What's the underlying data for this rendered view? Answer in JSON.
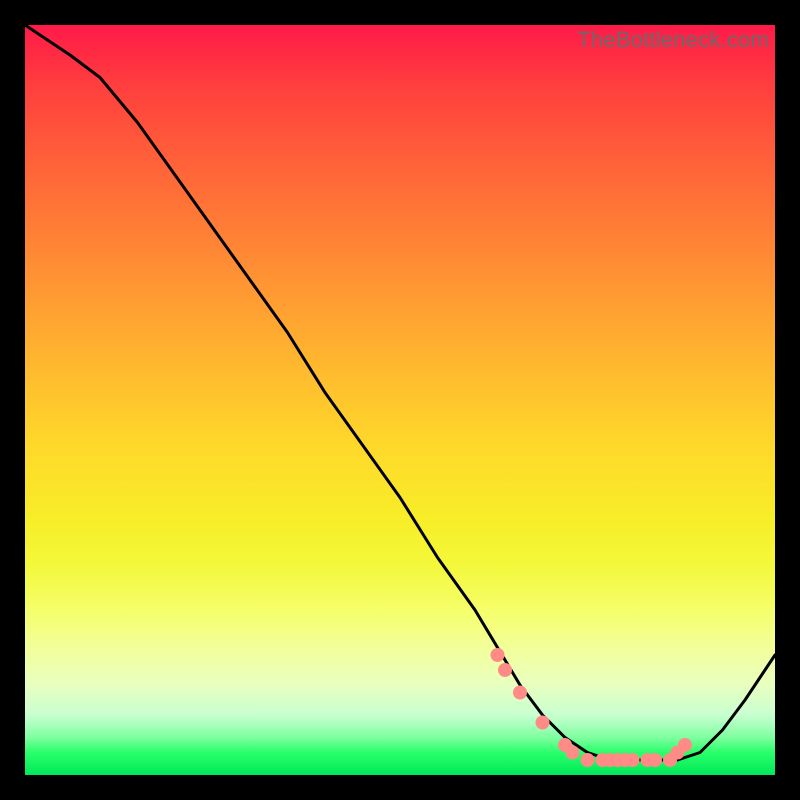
{
  "watermark": "TheBottleneck.com",
  "chart_data": {
    "type": "line",
    "title": "",
    "xlabel": "",
    "ylabel": "",
    "xlim": [
      0,
      100
    ],
    "ylim": [
      0,
      100
    ],
    "series": [
      {
        "name": "curve",
        "x": [
          0,
          3,
          6,
          10,
          15,
          20,
          25,
          30,
          35,
          40,
          45,
          50,
          55,
          60,
          63,
          66,
          69,
          72,
          75,
          78,
          81,
          84,
          87,
          90,
          93,
          96,
          100
        ],
        "y": [
          100,
          98,
          96,
          93,
          87,
          80,
          73,
          66,
          59,
          51,
          44,
          37,
          29,
          22,
          17,
          12,
          8,
          5,
          3,
          2,
          2,
          2,
          2,
          3,
          6,
          10,
          16
        ]
      }
    ],
    "markers": {
      "name": "highlight-points",
      "color": "#ff8b86",
      "x": [
        63,
        64,
        66,
        69,
        72,
        73,
        75,
        77,
        78,
        79,
        80,
        81,
        83,
        84,
        86,
        87,
        88
      ],
      "y": [
        16,
        14,
        11,
        7,
        4,
        3,
        2,
        2,
        2,
        2,
        2,
        2,
        2,
        2,
        2,
        3,
        4
      ]
    },
    "colors": {
      "line": "#000000",
      "marker": "#ff8b86",
      "gradient_top": "#ff1a49",
      "gradient_bottom": "#00e858"
    }
  }
}
